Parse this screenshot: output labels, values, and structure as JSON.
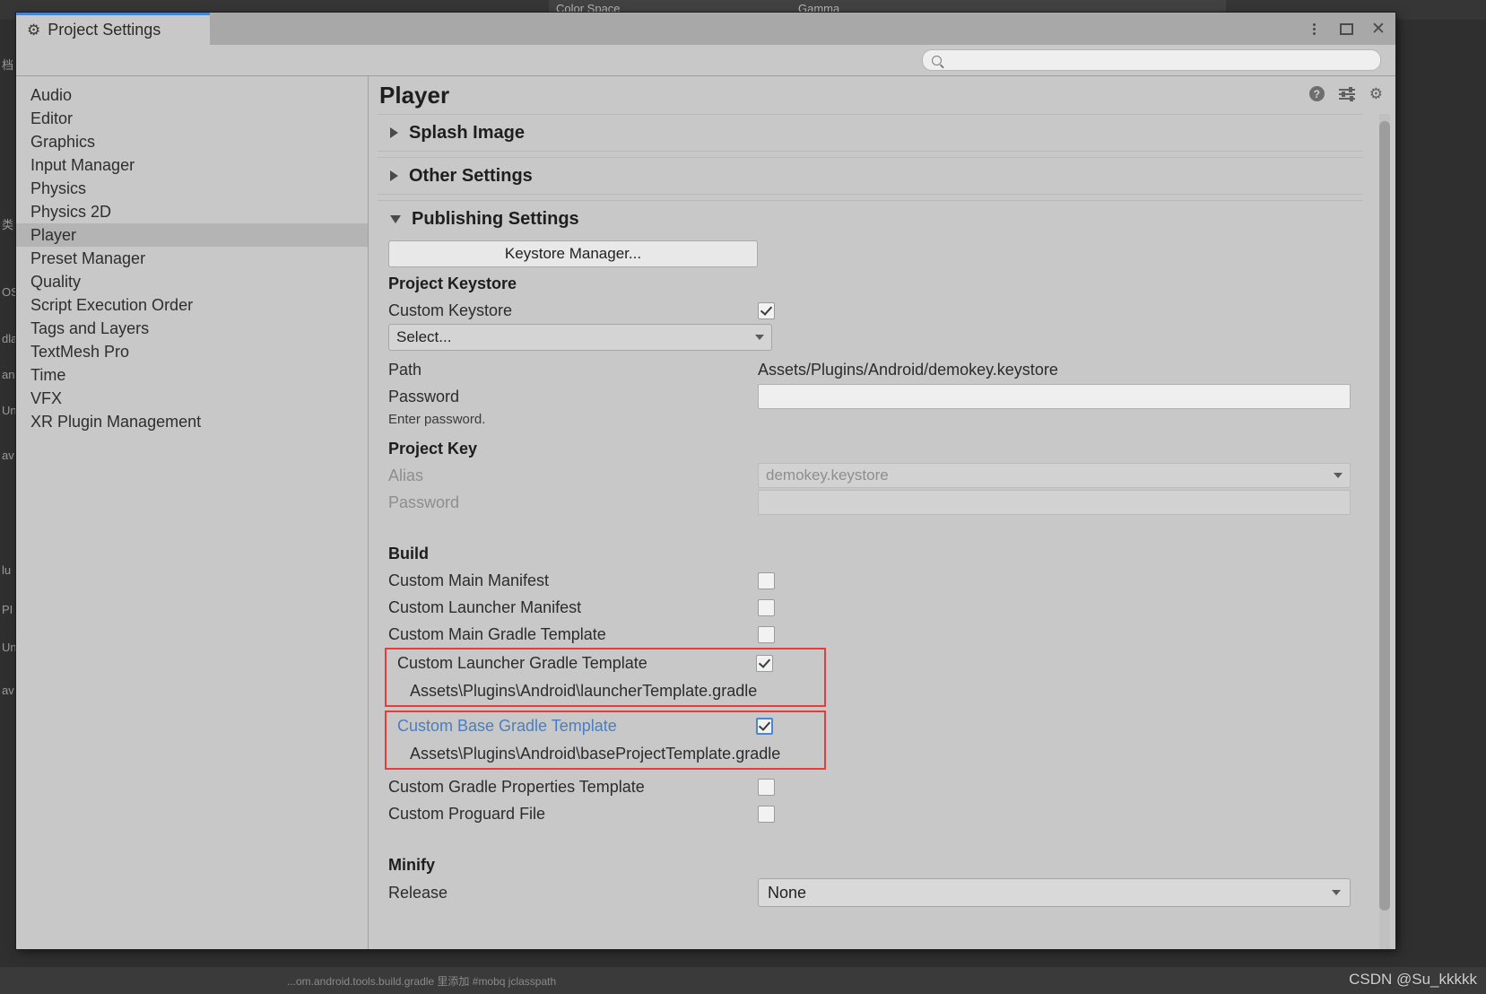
{
  "backdrop": {
    "color_space_label": "Color Space",
    "color_space_value": "Gamma",
    "bottom_status": "...om.android.tools.build.gradle 里添加 #mobq jclasspath",
    "left_labels": [
      "档",
      "类",
      "OS",
      "dla",
      "an",
      "Un",
      "av",
      "lu",
      "PI",
      "Un",
      "av"
    ]
  },
  "window": {
    "tab_title": "Project Settings",
    "gear_icon": "gear-icon",
    "controls": {
      "menu": "more-vertical-icon",
      "maximize": "maximize-icon",
      "close": "close-icon"
    }
  },
  "search": {
    "icon": "search-icon",
    "value": "",
    "placeholder": ""
  },
  "sidebar": {
    "items": [
      {
        "label": "Audio",
        "selected": false
      },
      {
        "label": "Editor",
        "selected": false
      },
      {
        "label": "Graphics",
        "selected": false
      },
      {
        "label": "Input Manager",
        "selected": false
      },
      {
        "label": "Physics",
        "selected": false
      },
      {
        "label": "Physics 2D",
        "selected": false
      },
      {
        "label": "Player",
        "selected": true
      },
      {
        "label": "Preset Manager",
        "selected": false
      },
      {
        "label": "Quality",
        "selected": false
      },
      {
        "label": "Script Execution Order",
        "selected": false
      },
      {
        "label": "Tags and Layers",
        "selected": false
      },
      {
        "label": "TextMesh Pro",
        "selected": false
      },
      {
        "label": "Time",
        "selected": false
      },
      {
        "label": "VFX",
        "selected": false
      },
      {
        "label": "XR Plugin Management",
        "selected": false
      }
    ]
  },
  "main": {
    "page_title": "Player",
    "header_icons": {
      "help": "help-icon",
      "presets": "preset-sliders-icon",
      "settings": "gear-icon"
    },
    "foldouts": {
      "splash_image": {
        "label": "Splash Image",
        "expanded": false
      },
      "other_settings": {
        "label": "Other Settings",
        "expanded": false
      },
      "publishing_settings": {
        "label": "Publishing Settings",
        "expanded": true
      }
    },
    "publishing": {
      "keystore_manager_button": "Keystore Manager...",
      "project_keystore_header": "Project Keystore",
      "custom_keystore_label": "Custom Keystore",
      "custom_keystore_checked": true,
      "keystore_select_value": "Select...",
      "path_label": "Path",
      "path_value": "Assets/Plugins/Android/demokey.keystore",
      "password_label": "Password",
      "password_value": "",
      "enter_password_hint": "Enter password.",
      "project_key_header": "Project Key",
      "alias_label": "Alias",
      "alias_value": "demokey.keystore",
      "key_password_label": "Password",
      "key_password_value": "",
      "build_header": "Build",
      "build_rows": [
        {
          "label": "Custom Main Manifest",
          "checked": false,
          "highlighted": false,
          "focused": false,
          "link": false,
          "path": null
        },
        {
          "label": "Custom Launcher Manifest",
          "checked": false,
          "highlighted": false,
          "focused": false,
          "link": false,
          "path": null
        },
        {
          "label": "Custom Main Gradle Template",
          "checked": false,
          "highlighted": false,
          "focused": false,
          "link": false,
          "path": null
        },
        {
          "label": "Custom Launcher Gradle Template",
          "checked": true,
          "highlighted": true,
          "focused": false,
          "link": false,
          "path": "Assets\\Plugins\\Android\\launcherTemplate.gradle"
        },
        {
          "label": "Custom Base Gradle Template",
          "checked": true,
          "highlighted": true,
          "focused": true,
          "link": true,
          "path": "Assets\\Plugins\\Android\\baseProjectTemplate.gradle"
        },
        {
          "label": "Custom Gradle Properties Template",
          "checked": false,
          "highlighted": false,
          "focused": false,
          "link": false,
          "path": null
        },
        {
          "label": "Custom Proguard File",
          "checked": false,
          "highlighted": false,
          "focused": false,
          "link": false,
          "path": null
        }
      ],
      "minify_header": "Minify",
      "release_label": "Release",
      "release_value": "None"
    }
  },
  "watermark": "CSDN @Su_kkkkk",
  "colors": {
    "accent_tab": "#4784d4",
    "highlight_red": "#ea3b3b",
    "link_blue": "#4a7ec0",
    "window_bg": "#c8c8c8",
    "selected_row": "#b4b4b4"
  }
}
